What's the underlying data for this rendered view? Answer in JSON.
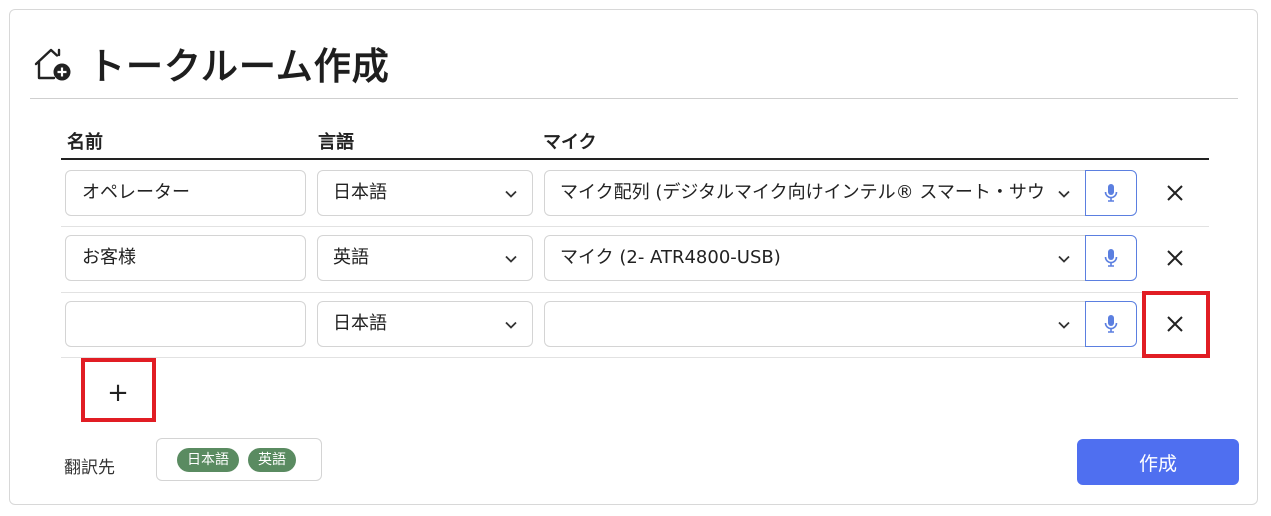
{
  "header": {
    "title": "トークルーム作成",
    "icon": "home-add-icon"
  },
  "table": {
    "columns": {
      "name": "名前",
      "language": "言語",
      "mic": "マイク"
    },
    "rows": [
      {
        "name": "オペレーター",
        "language": "日本語",
        "mic": "マイク配列 (デジタルマイク向けインテル® スマート・サウンド・テクノロジー)"
      },
      {
        "name": "お客様",
        "language": "英語",
        "mic": "マイク (2- ATR4800-USB)"
      },
      {
        "name": "",
        "language": "日本語",
        "mic": ""
      }
    ]
  },
  "add_button": {
    "label": "+"
  },
  "translation": {
    "label": "翻訳先",
    "targets": [
      "日本語",
      "英語"
    ]
  },
  "create_button": {
    "label": "作成"
  },
  "colors": {
    "accent": "#4f6ff0",
    "mic_border": "#5b7fe0",
    "chip": "#5a8b61",
    "highlight": "#e11d24"
  }
}
